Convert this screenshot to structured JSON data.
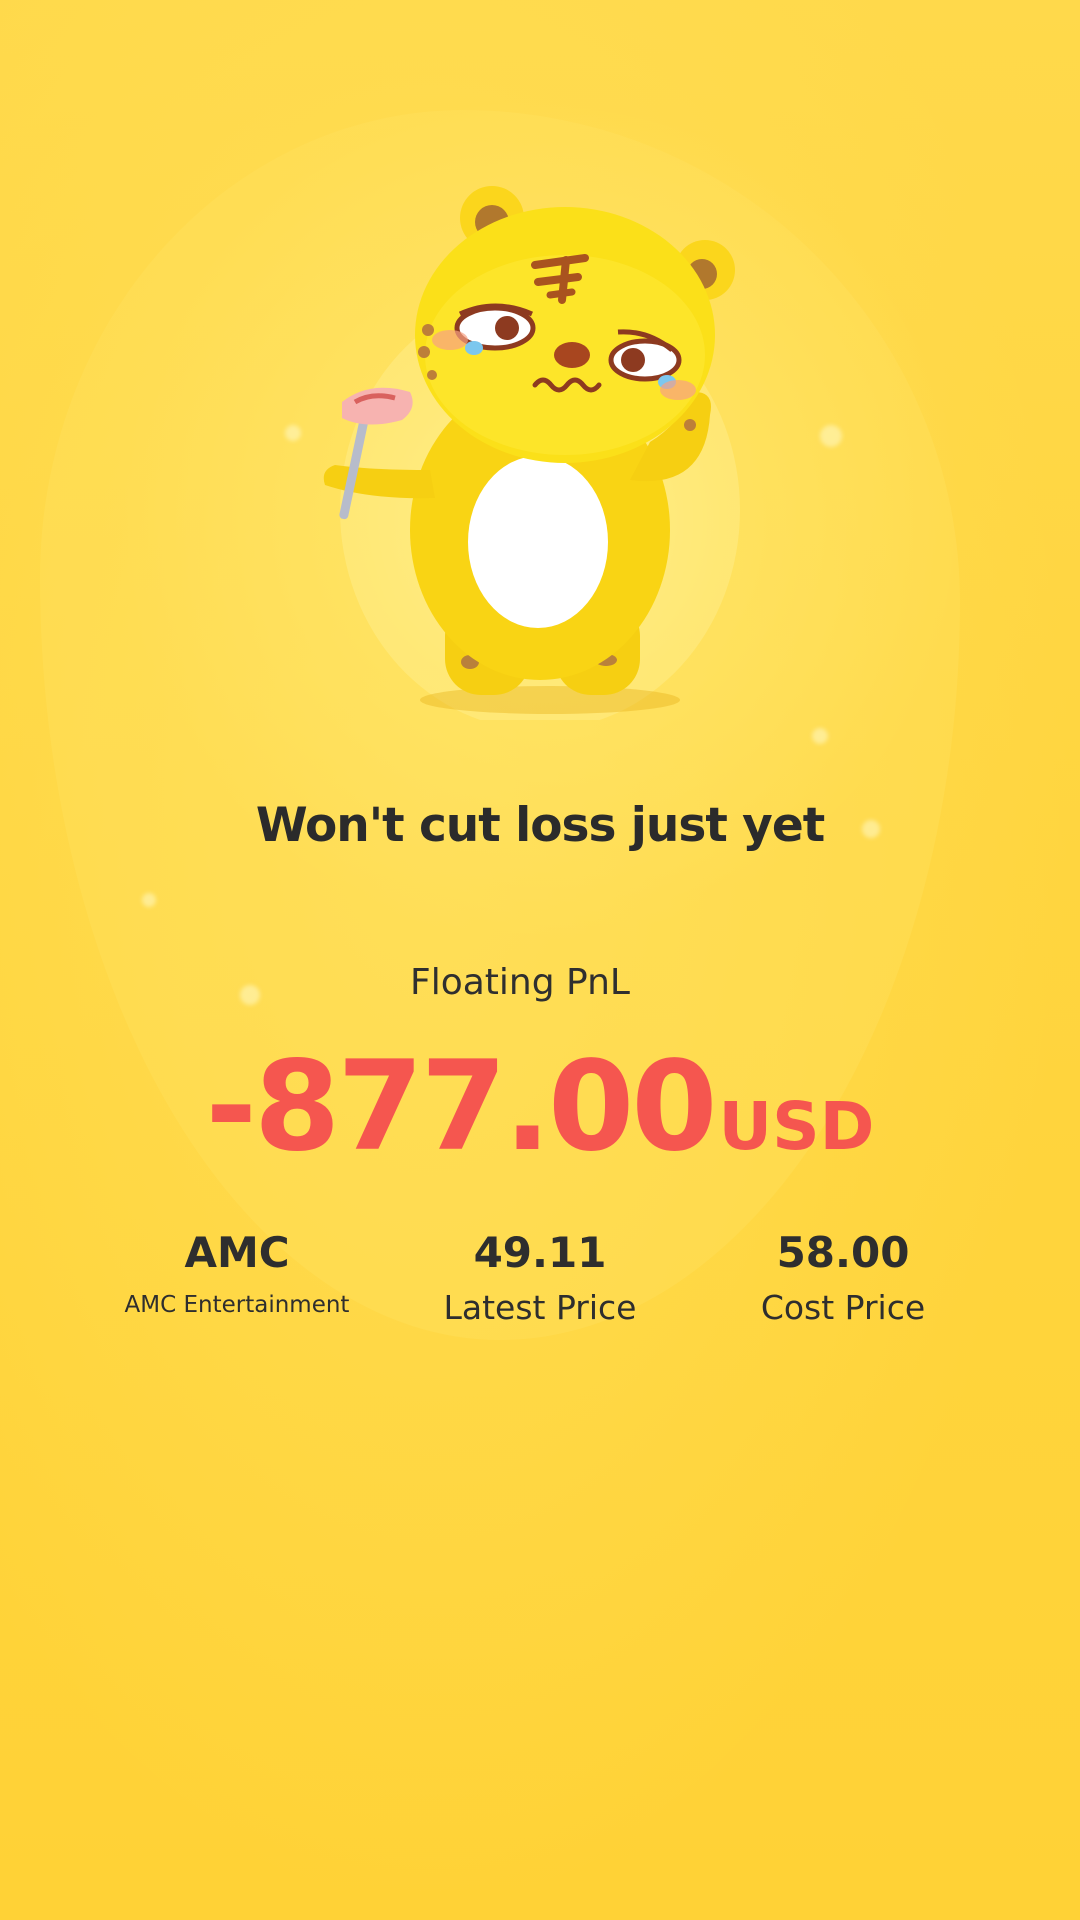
{
  "card": {
    "headline": "Won't cut loss just yet",
    "mascot_icon": "tiger-mascot-holding-steak-icon",
    "pnl": {
      "label": "Floating PnL",
      "value": "-877.00",
      "unit": "USD",
      "color": "#f5564f"
    },
    "stats": [
      {
        "value": "AMC",
        "label": "AMC Entertainment"
      },
      {
        "value": "49.11",
        "label": "Latest Price"
      },
      {
        "value": "58.00",
        "label": "Cost Price"
      }
    ]
  },
  "theme": {
    "background": "#fdd43a",
    "text": "#2b2b2b"
  }
}
